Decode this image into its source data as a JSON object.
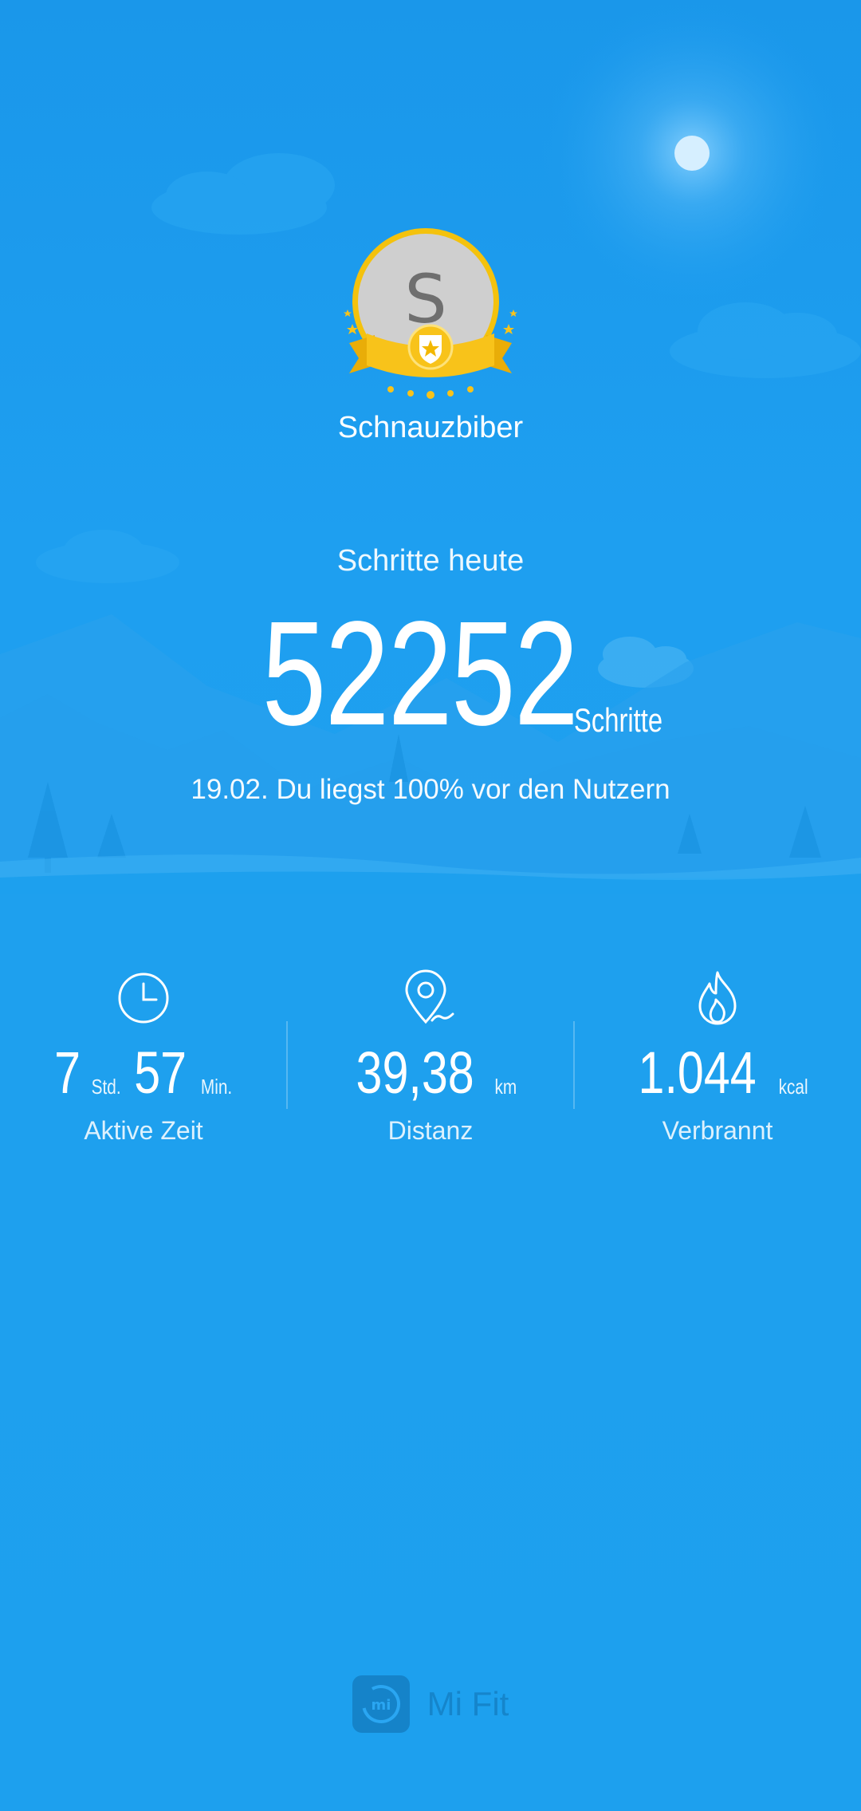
{
  "profile": {
    "avatar_initial": "S",
    "username": "Schnauzbiber"
  },
  "steps": {
    "label": "Schritte heute",
    "value": "52252",
    "unit": "Schritte",
    "rank_text": "19.02. Du liegst 100% vor den Nutzern"
  },
  "stats": {
    "active_time": {
      "icon": "clock-icon",
      "hours": "7",
      "hours_unit": "Std.",
      "minutes": "57",
      "minutes_unit": "Min.",
      "label": "Aktive Zeit"
    },
    "distance": {
      "icon": "location-pin-icon",
      "value": "39,38",
      "unit": "km",
      "label": "Distanz"
    },
    "calories": {
      "icon": "flame-icon",
      "value": "1.044",
      "unit": "kcal",
      "label": "Verbrannt"
    }
  },
  "footer": {
    "logo_text": "mi",
    "app_name": "Mi Fit"
  },
  "colors": {
    "background": "#1da0ee",
    "badge_gold": "#f4c20d",
    "avatar_gray": "#cfcfcf",
    "footer_blue": "#1585cb"
  }
}
